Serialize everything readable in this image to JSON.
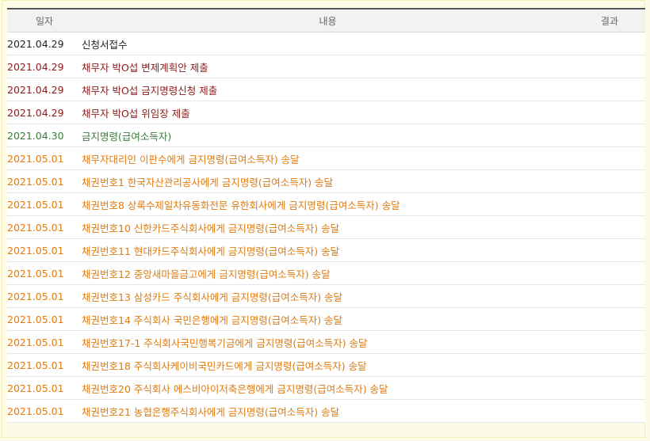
{
  "table": {
    "headers": {
      "date": "일자",
      "content": "내용",
      "result": "결과"
    },
    "colors": {
      "black": "#222222",
      "darkred": "#8b1a1a",
      "green": "#3a7d3a",
      "orange": "#e07b10"
    },
    "rows": [
      {
        "date": "2021.04.29",
        "content": "신청서접수",
        "result": "",
        "color": "black"
      },
      {
        "date": "2021.04.29",
        "content": "채무자 박O섭 변제계획안 제출",
        "result": "",
        "color": "darkred"
      },
      {
        "date": "2021.04.29",
        "content": "채무자 박O섭 금지명령신청 제출",
        "result": "",
        "color": "darkred"
      },
      {
        "date": "2021.04.29",
        "content": "채무자 박O섭 위임장 제출",
        "result": "",
        "color": "darkred"
      },
      {
        "date": "2021.04.30",
        "content": "금지명령(급여소득자)",
        "result": "",
        "color": "green"
      },
      {
        "date": "2021.05.01",
        "content": "채무자대리인 이판수에게 금지명령(급여소득자) 송달",
        "result": "",
        "color": "orange"
      },
      {
        "date": "2021.05.01",
        "content": "채권번호1 한국자산관리공사에게 금지명령(급여소득자) 송달",
        "result": "",
        "color": "orange"
      },
      {
        "date": "2021.05.01",
        "content": "채권번호8 상록수제일차유동화전문 유한회사에게 금지명령(급여소득자) 송달",
        "result": "",
        "color": "orange"
      },
      {
        "date": "2021.05.01",
        "content": "채권번호10 신한카드주식회사에게 금지명령(급여소득자) 송달",
        "result": "",
        "color": "orange"
      },
      {
        "date": "2021.05.01",
        "content": "채권번호11 현대카드주식회사에게 금지명령(급여소득자) 송달",
        "result": "",
        "color": "orange"
      },
      {
        "date": "2021.05.01",
        "content": "채권번호12 중앙새마을금고에게 금지명령(급여소득자) 송달",
        "result": "",
        "color": "orange"
      },
      {
        "date": "2021.05.01",
        "content": "채권번호13 삼성카드 주식회사에게 금지명령(급여소득자) 송달",
        "result": "",
        "color": "orange"
      },
      {
        "date": "2021.05.01",
        "content": "채권번호14 주식회사 국민은행에게 금지명령(급여소득자) 송달",
        "result": "",
        "color": "orange"
      },
      {
        "date": "2021.05.01",
        "content": "채권번호17-1 주식회사국민행복기금에게 금지명령(급여소득자) 송달",
        "result": "",
        "color": "orange"
      },
      {
        "date": "2021.05.01",
        "content": "채권번호18 주식회사케이비국민카드에게 금지명령(급여소득자) 송달",
        "result": "",
        "color": "orange"
      },
      {
        "date": "2021.05.01",
        "content": "채권번호20 주식회사 에스비아이저축은행에게 금지명령(급여소득자) 송달",
        "result": "",
        "color": "orange"
      },
      {
        "date": "2021.05.01",
        "content": "채권번호21 농협은행주식회사에게 금지명령(급여소득자) 송달",
        "result": "",
        "color": "orange"
      }
    ]
  }
}
